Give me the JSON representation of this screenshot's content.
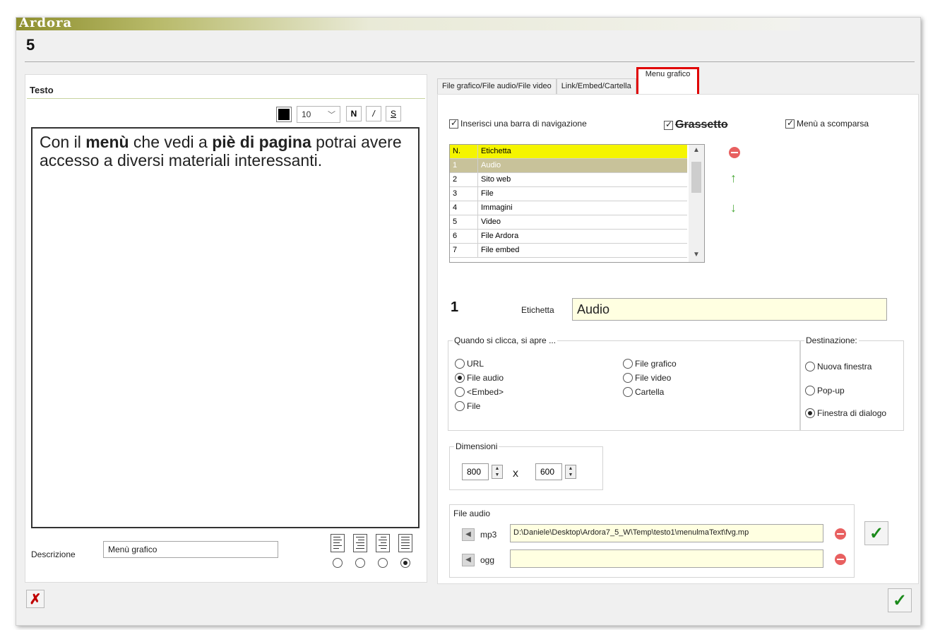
{
  "app": {
    "title": "Ardora",
    "page_number": "5"
  },
  "left_panel": {
    "header": "Testo",
    "toolbar": {
      "font_size": "10",
      "bold_label": "N",
      "italic_label": "/",
      "strike_label": "S"
    },
    "editor": {
      "segments": [
        {
          "text": "Con il ",
          "bold": false
        },
        {
          "text": "menù",
          "bold": true
        },
        {
          "text": " che vedi a ",
          "bold": false
        },
        {
          "text": "piè di pagina",
          "bold": true
        },
        {
          "text": " potrai avere accesso a diversi materiali interessanti.",
          "bold": false
        }
      ]
    },
    "description_label": "Descrizione",
    "description_value": "Menù grafico",
    "alignment_selected_index": 3
  },
  "tabs": [
    {
      "label": "File grafico/File audio/File video",
      "active": false
    },
    {
      "label": "Link/Embed/Cartella",
      "active": false
    },
    {
      "label": "Menu grafico",
      "active": true
    }
  ],
  "menu": {
    "nav_bar_label": "Inserisci una barra di navigazione",
    "nav_bar_checked": true,
    "bold_label": "Grassetto",
    "bold_checked": true,
    "dropdown_label": "Menù a scomparsa",
    "dropdown_checked": true,
    "grid": {
      "headers": [
        "N.",
        "Etichetta"
      ],
      "rows": [
        {
          "n": "1",
          "label": "Audio",
          "selected": true
        },
        {
          "n": "2",
          "label": "Sito web"
        },
        {
          "n": "3",
          "label": "File"
        },
        {
          "n": "4",
          "label": "Immagini"
        },
        {
          "n": "5",
          "label": "Video"
        },
        {
          "n": "6",
          "label": "File Ardora"
        },
        {
          "n": "7",
          "label": "File embed"
        }
      ]
    },
    "item_number": "1",
    "label_caption": "Etichetta",
    "label_value": "Audio",
    "opens_group_title": "Quando si clicca, si apre ...",
    "opens_options": [
      {
        "label": "URL",
        "selected": false
      },
      {
        "label": "File audio",
        "selected": true
      },
      {
        "label": "<Embed>",
        "selected": false
      },
      {
        "label": "File",
        "selected": false
      },
      {
        "label": "File grafico",
        "selected": false
      },
      {
        "label": "File video",
        "selected": false
      },
      {
        "label": "Cartella",
        "selected": false
      }
    ],
    "destination_title": "Destinazione:",
    "destination_options": [
      {
        "label": "Nuova finestra",
        "selected": false
      },
      {
        "label": "Pop-up",
        "selected": false
      },
      {
        "label": "Finestra di dialogo",
        "selected": true
      }
    ],
    "dimensions_title": "Dimensioni",
    "width_value": "800",
    "height_value": "600",
    "times_symbol": "x",
    "audio_group_title": "File audio",
    "mp3_label": "mp3",
    "mp3_path": "D:\\Daniele\\Desktop\\Ardora7_5_W\\Temp\\testo1\\menulmaText\\fvg.mp",
    "ogg_label": "ogg",
    "ogg_path": ""
  },
  "colors": {
    "accent_olive": "#8e8f2e",
    "highlight_red": "#e00000",
    "selected_row": "#c8c29a",
    "header_yellow": "#f5f500",
    "field_bg": "#ffffe1",
    "confirm_green": "#1b8a1b"
  }
}
